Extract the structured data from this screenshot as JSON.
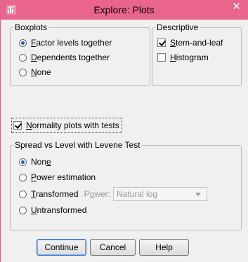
{
  "window": {
    "title": "Explore: Plots",
    "close_glyph": "✕"
  },
  "boxplots": {
    "legend": "Boxplots",
    "options": [
      {
        "label": "Factor levels together",
        "accel": "F",
        "rest": "actor levels together",
        "checked": true
      },
      {
        "label": "Dependents together",
        "accel": "D",
        "rest": "ependents together",
        "checked": false
      },
      {
        "label": "None",
        "accel": "N",
        "rest": "one",
        "checked": false
      }
    ]
  },
  "descriptive": {
    "legend": "Descriptive",
    "options": [
      {
        "label": "Stem-and-leaf",
        "accel": "S",
        "rest": "tem-and-leaf",
        "checked": true
      },
      {
        "label": "Histogram",
        "accel": "H",
        "rest": "istogram",
        "checked": false
      }
    ]
  },
  "normality": {
    "label": "Normality plots with tests",
    "accel": "N",
    "rest": "ormality plots with tests",
    "checked": true
  },
  "spread": {
    "legend": "Spread vs Level with Levene Test",
    "options": [
      {
        "label": "None",
        "pre": "Non",
        "accel": "e",
        "rest": "",
        "checked": true
      },
      {
        "label": "Power estimation",
        "pre": "",
        "accel": "P",
        "rest": "ower estimation",
        "checked": false
      },
      {
        "label": "Transformed",
        "pre": "",
        "accel": "T",
        "rest": "ransformed",
        "checked": false
      },
      {
        "label": "Untransformed",
        "pre": "",
        "accel": "U",
        "rest": "ntransformed",
        "checked": false
      }
    ],
    "power_label_pre": "P",
    "power_label_accel": "o",
    "power_label_rest": "wer:",
    "power_value": "Natural log"
  },
  "buttons": {
    "continue": "Continue",
    "cancel": "Cancel",
    "help": "Help"
  }
}
